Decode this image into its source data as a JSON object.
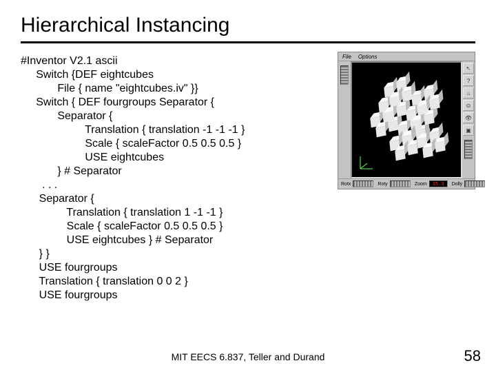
{
  "title": "Hierarchical Instancing",
  "code": "#Inventor V2.1 ascii\n     Switch {DEF eightcubes\n            File { name \"eightcubes.iv\" }}\n     Switch { DEF fourgroups Separator {\n            Separator {\n                     Translation { translation -1 -1 -1 }\n                     Scale { scaleFactor 0.5 0.5 0.5 }\n                     USE eightcubes\n            } # Separator\n       . . .\n      Separator {\n               Translation { translation 1 -1 -1 }\n               Scale { scaleFactor 0.5 0.5 0.5 }\n               USE eightcubes } # Separator\n      } }\n      USE fourgroups\n      Translation { translation 0 0 2 }\n      USE fourgroups",
  "viewer": {
    "menu": {
      "file": "File",
      "options": "Options"
    },
    "status": {
      "rotx_label": "Rotx",
      "roty_label": "Roty",
      "zoom_label": "Zoom",
      "dolly_label": "Dolly",
      "readout": "15.3"
    },
    "tools": {
      "pointer": "↖",
      "help": "?",
      "home": "⌂",
      "target": "⊙",
      "eye": "👁",
      "cam": "▣"
    }
  },
  "footer": "MIT EECS 6.837, Teller and Durand",
  "page": "58"
}
